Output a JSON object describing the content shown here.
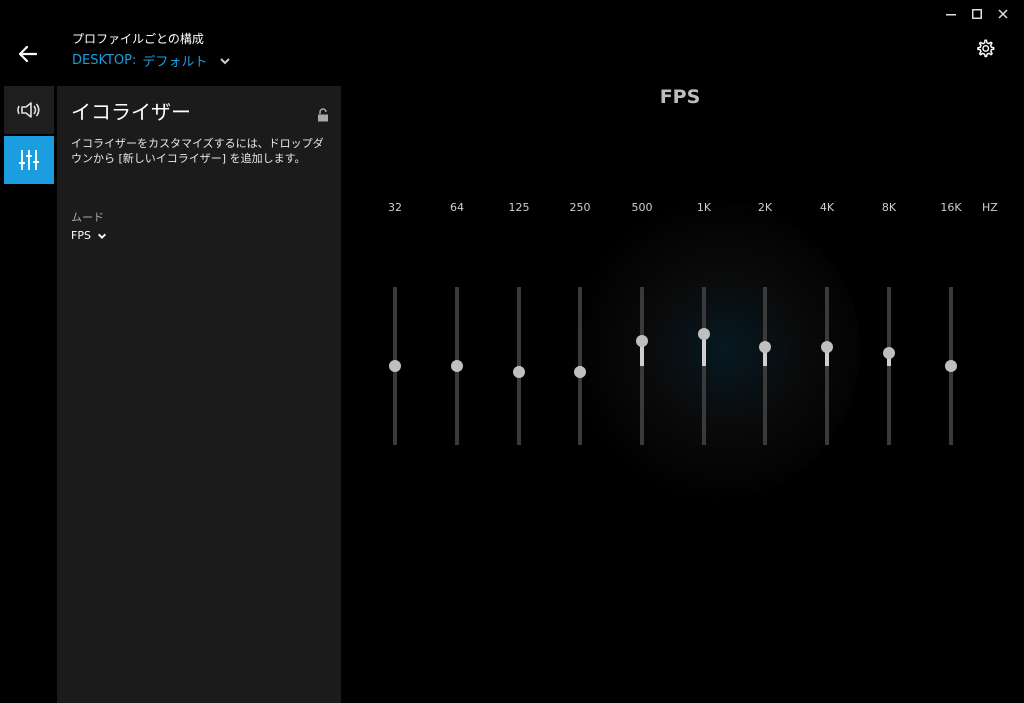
{
  "window_controls": {
    "minimize_icon": "minimize-icon",
    "maximize_icon": "maximize-icon",
    "close_icon": "close-icon"
  },
  "header": {
    "title": "プロファイルごとの構成",
    "profile_prefix": "DESKTOP:",
    "profile_name": "デフォルト"
  },
  "sidebar": {
    "tabs": [
      {
        "name": "audio-tab",
        "icon": "speaker-icon",
        "active": false
      },
      {
        "name": "equalizer-tab",
        "icon": "sliders-icon",
        "active": true
      }
    ]
  },
  "panel": {
    "title": "イコライザー",
    "description": "イコライザーをカスタマイズするには、ドロップダウンから [新しいイコライザー] を追加します。",
    "mode_label": "ムード",
    "mode_value": "FPS"
  },
  "equalizer": {
    "preset_name": "FPS",
    "unit": "HZ",
    "bands": [
      {
        "label": "32",
        "level": 0.0
      },
      {
        "label": "64",
        "level": 0.0
      },
      {
        "label": "125",
        "level": -0.08
      },
      {
        "label": "250",
        "level": -0.08
      },
      {
        "label": "500",
        "level": 0.32
      },
      {
        "label": "1K",
        "level": 0.4
      },
      {
        "label": "2K",
        "level": 0.24
      },
      {
        "label": "4K",
        "level": 0.24
      },
      {
        "label": "8K",
        "level": 0.16
      },
      {
        "label": "16K",
        "level": 0.0
      }
    ]
  },
  "colors": {
    "accent": "#1a9ee0",
    "panel": "#1b1b1b",
    "background": "#000000"
  }
}
